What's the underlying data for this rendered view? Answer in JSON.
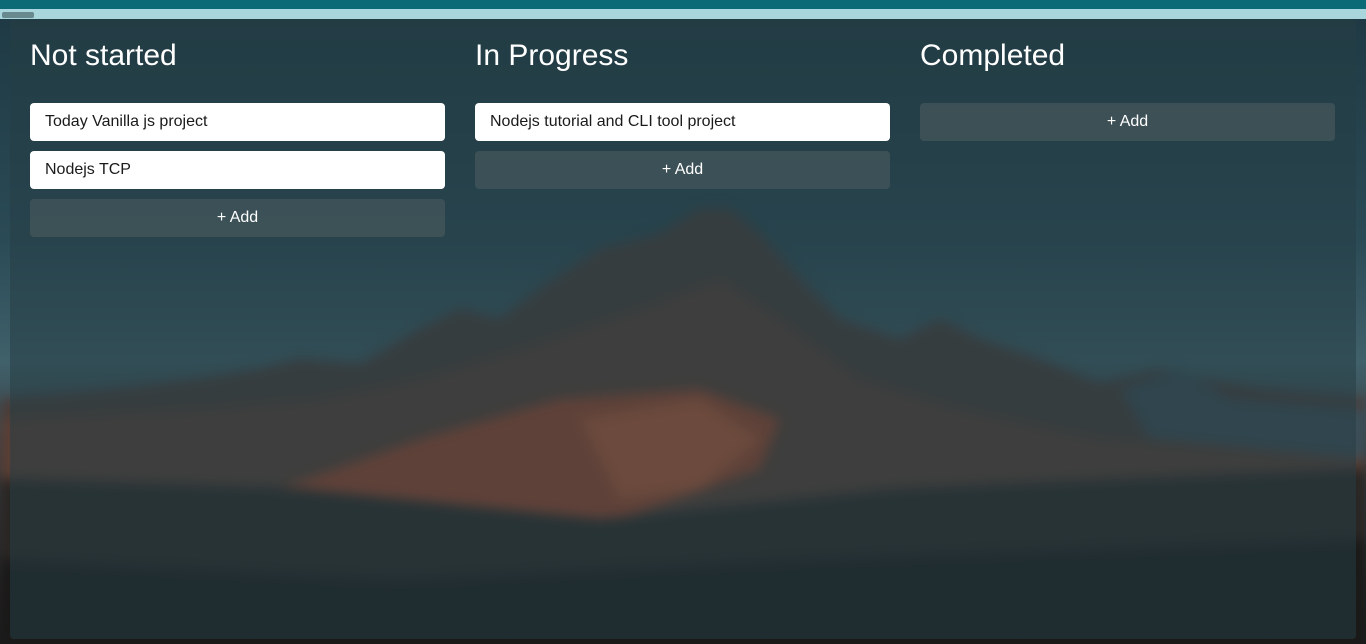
{
  "board": {
    "columns": [
      {
        "title": "Not started",
        "cards": [
          "Today Vanilla js project",
          "Nodejs TCP"
        ],
        "add_label": "+ Add"
      },
      {
        "title": "In Progress",
        "cards": [
          "Nodejs tutorial and CLI tool project"
        ],
        "add_label": "+ Add"
      },
      {
        "title": "Completed",
        "cards": [],
        "add_label": "+ Add"
      }
    ]
  },
  "colors": {
    "top_bar": "#0c6a76",
    "card_bg": "#ffffff",
    "text_light": "#ffffff"
  }
}
